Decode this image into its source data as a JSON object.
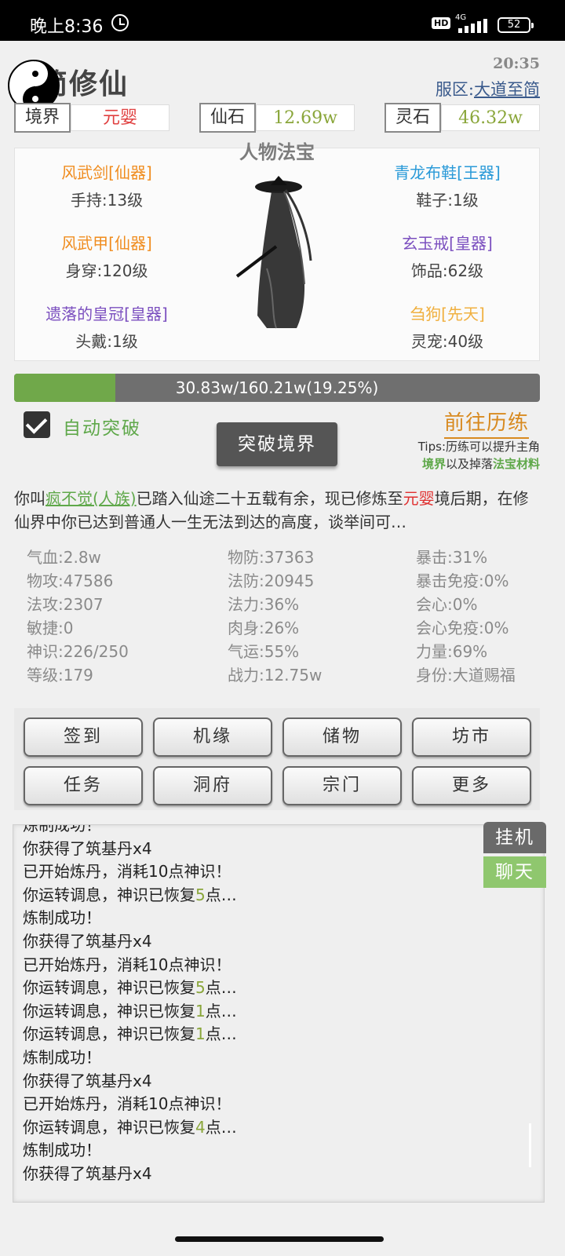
{
  "status_bar": {
    "time": "晚上8:36",
    "network": "4G",
    "hd": "HD",
    "battery": "52"
  },
  "header": {
    "title": "简修仙",
    "clock": "20:35",
    "server_label": "服区:",
    "server_name": "大道至简"
  },
  "resources": {
    "realm": {
      "label": "境界",
      "value": "元婴",
      "color": "#e04040"
    },
    "xianshi": {
      "label": "仙石",
      "value": "12.69w",
      "color": "#8aa63a"
    },
    "lingshi": {
      "label": "灵石",
      "value": "46.32w",
      "color": "#8aa63a"
    }
  },
  "equipment": {
    "title": "人物法宝",
    "items": [
      {
        "name": "风武剑[仙器]",
        "slot": "手持:13级",
        "color": "#f08c1e"
      },
      {
        "name": "风武甲[仙器]",
        "slot": "身穿:120级",
        "color": "#f08c1e"
      },
      {
        "name": "遗落的皇冠[皇器]",
        "slot": "头戴:1级",
        "color": "#7b4fbf"
      },
      {
        "name": "青龙布鞋[王器]",
        "slot": "鞋子:1级",
        "color": "#2a9ad8"
      },
      {
        "name": "玄玉戒[皇器]",
        "slot": "饰品:62级",
        "color": "#7b4fbf"
      },
      {
        "name": "刍狗[先天]",
        "slot": "灵宠:40级",
        "color": "#f0b040"
      }
    ]
  },
  "progress": {
    "text": "30.83w/160.21w(19.25%)",
    "fraction": 0.1925
  },
  "controls": {
    "auto_break_label": "自动突破",
    "auto_break_checked": true,
    "break_button": "突破境界",
    "goto_training": "前往历练",
    "tips_line1": "Tips:历练可以提升主角",
    "tips_realm": "境界",
    "tips_mid": "以及掉落",
    "tips_material": "法宝材料"
  },
  "description": {
    "prefix": "你叫",
    "name": "疯不觉(人族)",
    "mid": "已踏入仙途二十五载有余，现已修炼至",
    "realm": "元婴",
    "suffix": "境后期，在修仙界中你已达到普通人一生无法到达的高度，谈举间可…"
  },
  "stats": {
    "col1": [
      "气血:2.8w",
      "物攻:47586",
      "法攻:2307",
      "敏捷:0",
      "神识:226/250",
      "等级:179"
    ],
    "col2": [
      "物防:37363",
      "法防:20945",
      "法力:36%",
      "肉身:26%",
      "气运:55%",
      "战力:12.75w"
    ],
    "col3": [
      "暴击:31%",
      "暴击免疫:0%",
      "会心:0%",
      "会心免疫:0%",
      "力量:69%",
      "身份:大道赐福"
    ]
  },
  "menu_buttons": [
    "签到",
    "机缘",
    "储物",
    "坊市",
    "任务",
    "洞府",
    "宗门",
    "更多"
  ],
  "side_buttons": {
    "hang": "挂机",
    "chat": "聊天"
  },
  "log": [
    {
      "text": "炼制成功！"
    },
    {
      "text": "你获得了筑基丹x4"
    },
    {
      "text": "已开始炼丹，消耗10点神识！"
    },
    {
      "pre": "你运转调息，神识已恢复",
      "num": "5",
      "post": "点…"
    },
    {
      "text": "炼制成功！"
    },
    {
      "text": "你获得了筑基丹x4"
    },
    {
      "text": "已开始炼丹，消耗10点神识！"
    },
    {
      "pre": "你运转调息，神识已恢复",
      "num": "5",
      "post": "点…"
    },
    {
      "pre": "你运转调息，神识已恢复",
      "num": "1",
      "post": "点…"
    },
    {
      "pre": "你运转调息，神识已恢复",
      "num": "1",
      "post": "点…"
    },
    {
      "text": "炼制成功！"
    },
    {
      "text": "你获得了筑基丹x4"
    },
    {
      "text": "已开始炼丹，消耗10点神识！"
    },
    {
      "pre": "你运转调息，神识已恢复",
      "num": "4",
      "post": "点…"
    },
    {
      "text": "炼制成功！"
    },
    {
      "text": "你获得了筑基丹x4"
    }
  ]
}
